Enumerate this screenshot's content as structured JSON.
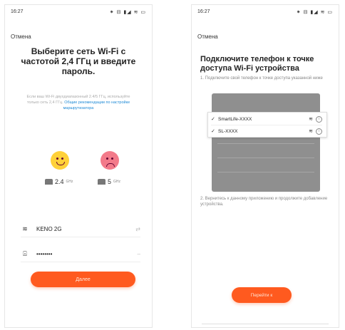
{
  "left": {
    "status_time": "16:27",
    "status_icons": "⁕ ⊟ ▮◢ ≋ ▭",
    "cancel_label": "Отмена",
    "title": "Выберите сеть Wi-Fi с частотой 2,4 ГГц и введите пароль.",
    "description_text": "Если ваш Wi-Fi двухдиапазонный 2.4/5 ГГц, используйте только сеть 2,4 ГГц.",
    "description_link": "Общие рекомендации по настройке маршрутизатора",
    "band_good": "2.4",
    "band_good_unit": "GHz",
    "band_bad": "5",
    "band_bad_unit": "GHz",
    "wifi_name": "KENO 2G",
    "password_mask": "••••••••",
    "next_label": "Далее",
    "icons": {
      "wifi": "wifi-icon",
      "lock": "lock-icon",
      "router": "router-icon",
      "switch": "switch-network-icon",
      "eye": "show-password-icon"
    },
    "colors": {
      "accent": "#ff5a1f",
      "link": "#1f8ad6",
      "good_face": "#ffd13a",
      "bad_face": "#f37a8a"
    }
  },
  "right": {
    "status_time": "16:27",
    "status_icons": "⁕ ⊟ ▮◢ ≋ ▭",
    "cancel_label": "Отмена",
    "title": "Подключите телефон к точке доступа Wi-Fi устройства",
    "step1": "1. Подключите свой телефон к точке доступа указанной ниже",
    "networks": [
      {
        "name": "SmartLife-XXXX"
      },
      {
        "name": "SL-XXXX"
      }
    ],
    "step2": "2. Вернитесь к данному приложению и продолжите добавление устройства.",
    "go_label": "Перейти к"
  }
}
